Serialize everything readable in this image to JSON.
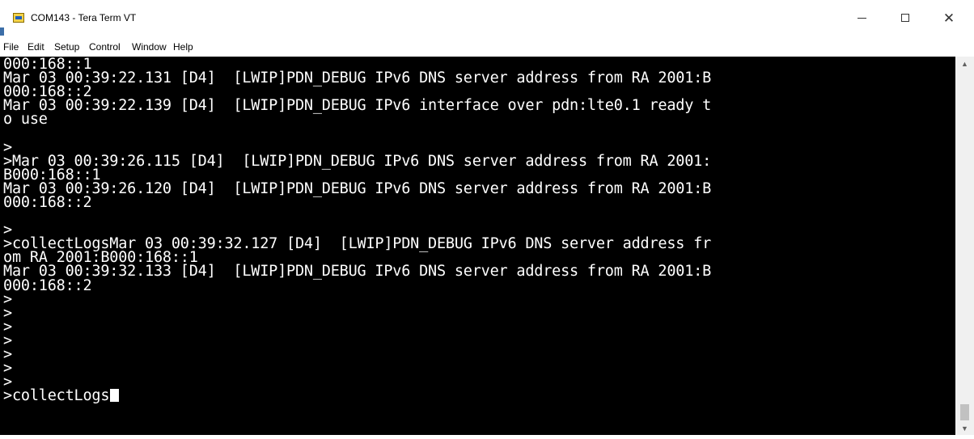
{
  "window": {
    "title": "COM143 - Tera Term VT",
    "icon": "teraterm-app-icon"
  },
  "controls": {
    "minimize_icon": "minimize-icon",
    "maximize_icon": "maximize-icon",
    "close_icon": "close-icon",
    "close_glyph": "✕"
  },
  "menu": {
    "items": [
      "File",
      "Edit",
      "Setup",
      "Control",
      "Window",
      "Help"
    ]
  },
  "terminal": {
    "lines": [
      "000:168::1",
      "Mar 03 00:39:22.131 [D4]  [LWIP]PDN_DEBUG IPv6 DNS server address from RA 2001:B",
      "000:168::2",
      "Mar 03 00:39:22.139 [D4]  [LWIP]PDN_DEBUG IPv6 interface over pdn:lte0.1 ready t",
      "o use",
      "",
      ">",
      ">Mar 03 00:39:26.115 [D4]  [LWIP]PDN_DEBUG IPv6 DNS server address from RA 2001:",
      "B000:168::1",
      "Mar 03 00:39:26.120 [D4]  [LWIP]PDN_DEBUG IPv6 DNS server address from RA 2001:B",
      "000:168::2",
      "",
      ">",
      ">collectLogsMar 03 00:39:32.127 [D4]  [LWIP]PDN_DEBUG IPv6 DNS server address fr",
      "om RA 2001:B000:168::1",
      "Mar 03 00:39:32.133 [D4]  [LWIP]PDN_DEBUG IPv6 DNS server address from RA 2001:B",
      "000:168::2",
      ">",
      ">",
      ">",
      ">",
      ">",
      ">",
      ">",
      ">collectLogs"
    ],
    "background": "#000000",
    "foreground": "#ffffff"
  },
  "scrollbar": {
    "up_arrow": "▲",
    "down_arrow": "▼"
  }
}
